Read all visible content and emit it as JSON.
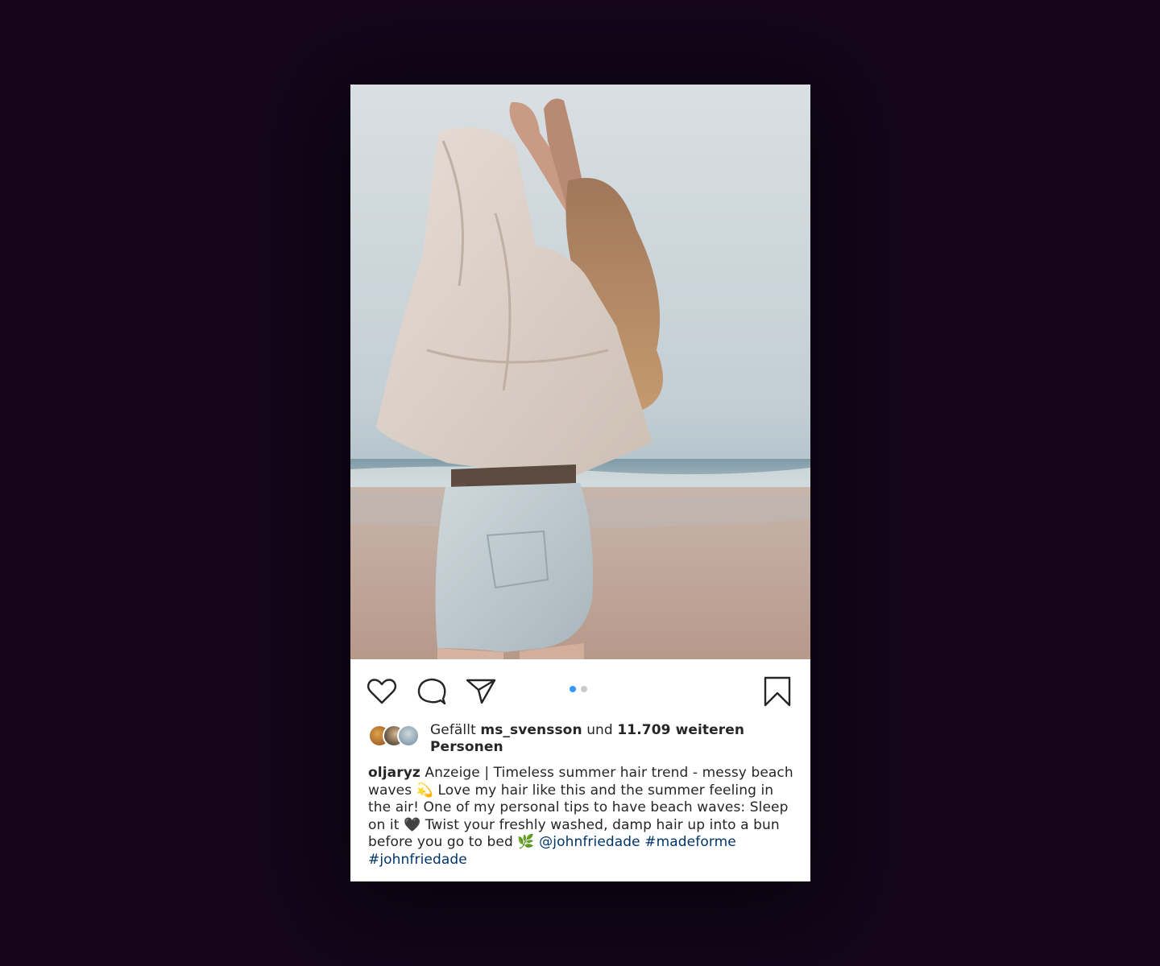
{
  "post": {
    "image_alt": "Woman on a beach with arms raised, wearing an oversized beige jacket and denim shorts",
    "carousel": {
      "count": 2,
      "active_index": 0
    },
    "actions": {
      "like_icon": "heart-outline-icon",
      "comment_icon": "comment-bubble-icon",
      "share_icon": "paper-plane-icon",
      "save_icon": "bookmark-outline-icon"
    },
    "likes": {
      "prefix": "Gefällt",
      "user": "ms_svensson",
      "connector": "und",
      "count_text": "11.709 weiteren",
      "suffix": "Personen"
    },
    "caption": {
      "username": "oljaryz",
      "text_1": "Anzeige | Timeless summer hair trend - messy beach waves 💫 Love my hair like this and the summer feeling in the air! One of my personal tips to have beach waves: Sleep on it 🖤 Twist your freshly washed, damp hair up into a bun before you go to bed 🌿",
      "mention": "@johnfriedade",
      "hashtag_1": "#madeforme",
      "hashtag_2": "#johnfriedade"
    },
    "colors": {
      "background": "#15061c",
      "card": "#ffffff",
      "link": "#003569",
      "active_dot": "#3897f0",
      "inactive_dot": "#c9c9c9",
      "text": "#262626"
    }
  }
}
